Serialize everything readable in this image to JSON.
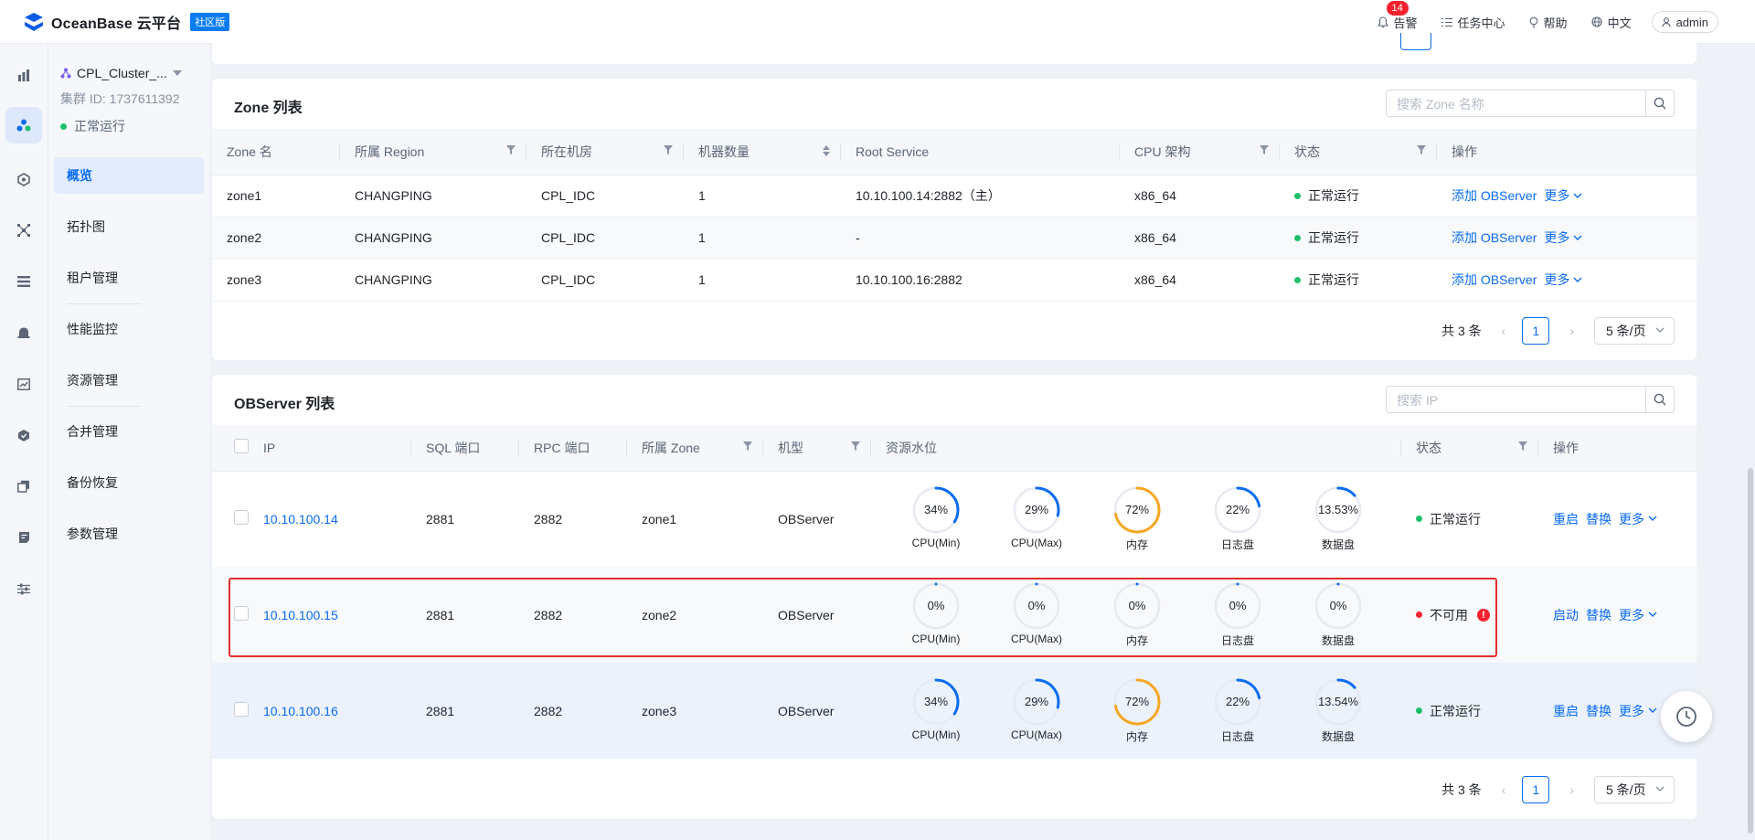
{
  "topnav": {
    "brand": "OceanBase 云平台",
    "edition": "社区版",
    "alarm_label": "告警",
    "alarm_count": "14",
    "tasks_label": "任务中心",
    "help_label": "帮助",
    "lang_label": "中文",
    "user_label": "admin"
  },
  "rail_icons": [
    "bar-chart-icon",
    "cluster-icon",
    "hexagon-icon",
    "topology-icon",
    "list-icon",
    "alarm-bell-icon",
    "monitor-chart-icon",
    "shield-icon",
    "copy-icon",
    "document-icon",
    "sliders-icon"
  ],
  "cluster": {
    "name": "CPL_Cluster_...",
    "id_text": "集群 ID: 1737611392",
    "status": "正常运行"
  },
  "menu": {
    "items": [
      {
        "label": "概览"
      },
      {
        "label": "拓扑图"
      },
      {
        "label": "租户管理"
      },
      {
        "label": "性能监控"
      },
      {
        "label": "资源管理"
      },
      {
        "label": "合并管理"
      },
      {
        "label": "备份恢复"
      },
      {
        "label": "参数管理"
      }
    ]
  },
  "zone_card": {
    "title": "Zone 列表",
    "search_placeholder": "搜索 Zone 名称",
    "columns": [
      "Zone 名",
      "所属 Region",
      "所在机房",
      "机器数量",
      "Root Service",
      "CPU 架构",
      "状态",
      "操作"
    ],
    "rows": [
      {
        "zone": "zone1",
        "region": "CHANGPING",
        "idc": "CPL_IDC",
        "count": "1",
        "root": "10.10.100.14:2882（主）",
        "arch": "x86_64",
        "status": "正常运行",
        "action": "添加 OBServer",
        "more": "更多"
      },
      {
        "zone": "zone2",
        "region": "CHANGPING",
        "idc": "CPL_IDC",
        "count": "1",
        "root": "-",
        "arch": "x86_64",
        "status": "正常运行",
        "action": "添加 OBServer",
        "more": "更多"
      },
      {
        "zone": "zone3",
        "region": "CHANGPING",
        "idc": "CPL_IDC",
        "count": "1",
        "root": "10.10.100.16:2882",
        "arch": "x86_64",
        "status": "正常运行",
        "action": "添加 OBServer",
        "more": "更多"
      }
    ],
    "pager": {
      "total": "共 3 条",
      "page": "1",
      "size": "5 条/页"
    }
  },
  "ob_card": {
    "title": "OBServer 列表",
    "search_placeholder": "搜索 IP",
    "columns": [
      "IP",
      "SQL 端口",
      "RPC 端口",
      "所属 Zone",
      "机型",
      "资源水位",
      "状态",
      "操作"
    ],
    "gauge_labels": [
      "CPU(Min)",
      "CPU(Max)",
      "内存",
      "日志盘",
      "数据盘"
    ],
    "rows": [
      {
        "ip": "10.10.100.14",
        "sql": "2881",
        "rpc": "2882",
        "zone": "zone1",
        "type": "OBServer",
        "gauges": [
          {
            "text": "34%",
            "pct": 34,
            "color": "#0a6cf0"
          },
          {
            "text": "29%",
            "pct": 29,
            "color": "#0a6cf0"
          },
          {
            "text": "72%",
            "pct": 72,
            "color": "#f5a623"
          },
          {
            "text": "22%",
            "pct": 22,
            "color": "#0a6cf0"
          },
          {
            "text": "13.53%",
            "pct": 13.53,
            "color": "#0a6cf0"
          }
        ],
        "status": "正常运行",
        "ok": true,
        "action1": "重启",
        "action2": "替换",
        "more": "更多"
      },
      {
        "ip": "10.10.100.15",
        "sql": "2881",
        "rpc": "2882",
        "zone": "zone2",
        "type": "OBServer",
        "gauges": [
          {
            "text": "0%",
            "pct": 0,
            "color": "#0a6cf0"
          },
          {
            "text": "0%",
            "pct": 0,
            "color": "#0a6cf0"
          },
          {
            "text": "0%",
            "pct": 0,
            "color": "#0a6cf0"
          },
          {
            "text": "0%",
            "pct": 0,
            "color": "#0a6cf0"
          },
          {
            "text": "0%",
            "pct": 0,
            "color": "#0a6cf0"
          }
        ],
        "status": "不可用",
        "ok": false,
        "action1": "启动",
        "action2": "替换",
        "more": "更多"
      },
      {
        "ip": "10.10.100.16",
        "sql": "2881",
        "rpc": "2882",
        "zone": "zone3",
        "type": "OBServer",
        "gauges": [
          {
            "text": "34%",
            "pct": 34,
            "color": "#0a6cf0"
          },
          {
            "text": "29%",
            "pct": 29,
            "color": "#0a6cf0"
          },
          {
            "text": "72%",
            "pct": 72,
            "color": "#f5a623"
          },
          {
            "text": "22%",
            "pct": 22,
            "color": "#0a6cf0"
          },
          {
            "text": "13.54%",
            "pct": 13.54,
            "color": "#0a6cf0"
          }
        ],
        "status": "正常运行",
        "ok": true,
        "action1": "重启",
        "action2": "替换",
        "more": "更多"
      }
    ],
    "pager": {
      "total": "共 3 条",
      "page": "1",
      "size": "5 条/页"
    }
  },
  "floating_button_icon": "clock-icon"
}
